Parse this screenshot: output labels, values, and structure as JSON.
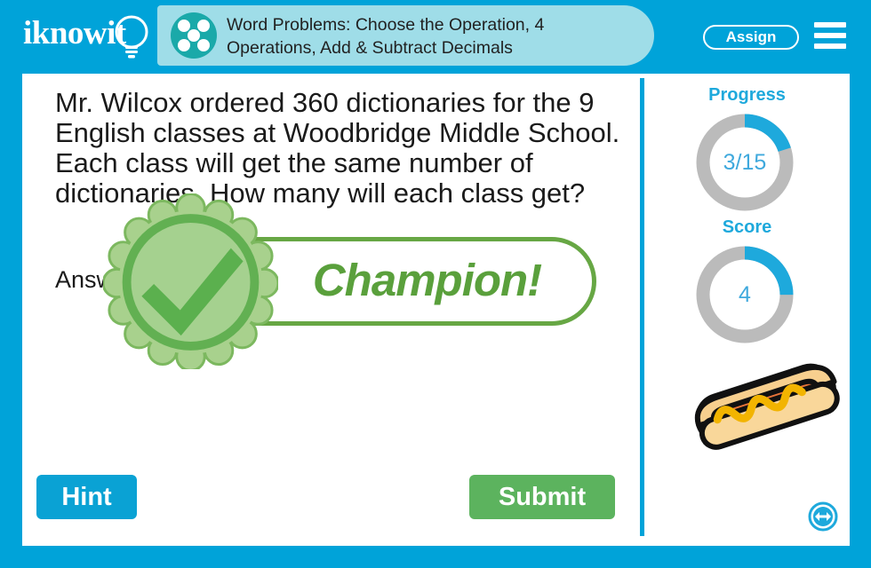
{
  "header": {
    "brand_name": "iknowit",
    "brand_icon": "lightbulb-icon",
    "lesson_icon": "five-dots-icon",
    "title_line1": "Word Problems: Choose the Operation, 4",
    "title_line2": "Operations, Add & Subtract Decimals",
    "assign_label": "Assign",
    "menu_icon": "hamburger-menu-icon",
    "bar_color": "#00a3d9",
    "pill_color": "#9fdde8",
    "badge_color": "#1aa9a9"
  },
  "question": {
    "text": "Mr. Wilcox ordered 360 dictionaries for the 9 English classes at Woodbridge Middle School. Each class will get the same number of dictionaries. How many will each class get?",
    "answer_label": "Answer:"
  },
  "feedback": {
    "banner_text": "Champion!",
    "badge_icon": "check-mark-badge-icon",
    "green": "#5aa03c",
    "border_green": "#67a744",
    "petal_green": "#a8d18d",
    "ring_green": "#62b052"
  },
  "actions": {
    "hint_label": "Hint",
    "hint_color": "#0aa2d4",
    "submit_label": "Submit",
    "submit_color": "#5cb35e"
  },
  "sidebar": {
    "progress": {
      "title": "Progress",
      "value": "3/15",
      "percent": 20
    },
    "score": {
      "title": "Score",
      "value": "4",
      "percent": 25
    },
    "reward_icon": "hot-dog-icon",
    "next_icon": "resize-arrows-icon",
    "accent": "#1ea9dc",
    "track": "#bbbbbb"
  }
}
